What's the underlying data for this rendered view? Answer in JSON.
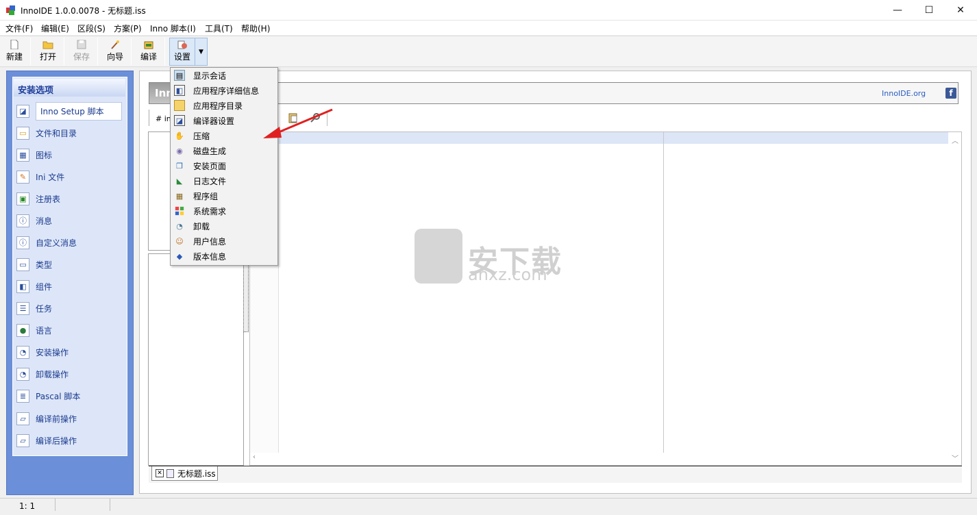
{
  "window": {
    "title": "InnoIDE 1.0.0.0078 - 无标题.iss",
    "minimize": "—",
    "maximize": "☐",
    "close": "✕"
  },
  "menu": [
    "文件(F)",
    "编辑(E)",
    "区段(S)",
    "方案(P)",
    "Inno 脚本(I)",
    "工具(T)",
    "帮助(H)"
  ],
  "toolbar": {
    "new": "新建",
    "open": "打开",
    "save": "保存",
    "wizard": "向导",
    "compile": "编译",
    "settings": "设置"
  },
  "left_panel": {
    "header": "安装选项",
    "items": [
      "Inno Setup 脚本",
      "文件和目录",
      "图标",
      "Ini 文件",
      "注册表",
      "消息",
      "自定义消息",
      "类型",
      "组件",
      "任务",
      "语言",
      "安装操作",
      "卸载操作",
      "Pascal 脚本",
      "编译前操作",
      "编译后操作"
    ]
  },
  "main": {
    "head_title": "Inno",
    "link": "InnoIDE.org",
    "hash_label": "# ino"
  },
  "dropdown": {
    "items": [
      "显示会话",
      "应用程序详细信息",
      "应用程序目录",
      "编译器设置",
      "压缩",
      "磁盘生成",
      "安装页面",
      "日志文件",
      "程序组",
      "系统需求",
      "卸载",
      "用户信息",
      "版本信息"
    ]
  },
  "tabs": {
    "doc": "无标题.iss"
  },
  "status": {
    "pos": "1:   1"
  },
  "watermark": {
    "text": "安下载",
    "url": "anxz.com"
  },
  "colors": {
    "accent_panel": "#6b8fd8",
    "panel_text": "#1a3a8f",
    "arrow": "#e02020"
  }
}
